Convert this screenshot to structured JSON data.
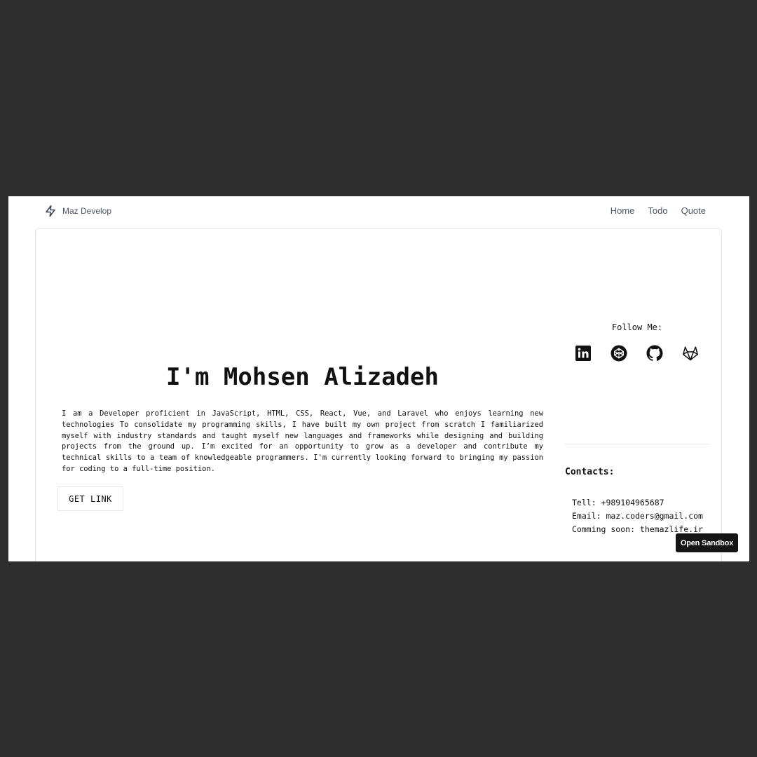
{
  "navbar": {
    "brand": "Maz Develop",
    "links": [
      "Home",
      "Todo",
      "Quote"
    ]
  },
  "hero": {
    "title": "I'm Mohsen Alizadeh",
    "description": "I am a Developer proficient in JavaScript, HTML, CSS, React, Vue, and Laravel who enjoys learning new technologies To consolidate my programming skills, I have built my own project from scratch I familiarized myself with industry standards and taught myself new languages and frameworks while designing and building projects from the ground up. I’m excited for an opportunity to grow as a developer and contribute my technical skills to a team of knowledgeable programmers. I'm currently looking forward to bringing my passion for coding to a full-time position.",
    "button_label": "GET LINK"
  },
  "follow": {
    "title": "Follow Me:",
    "icons": [
      "linkedin-icon",
      "codepen-icon",
      "github-icon",
      "gitlab-icon"
    ]
  },
  "contacts": {
    "title": "Contacts:",
    "tell": "Tell: +989104965687",
    "email": "Email: maz.coders@gmail.com",
    "soon": "Comming soon: themazlife.ir"
  },
  "sandbox": {
    "label": "Open Sandbox"
  },
  "colors": {
    "backdrop": "#2e2e2e",
    "page": "#ffffff",
    "text": "#111111",
    "nav_text": "#4b5563",
    "sandbox_bg": "#151515"
  }
}
